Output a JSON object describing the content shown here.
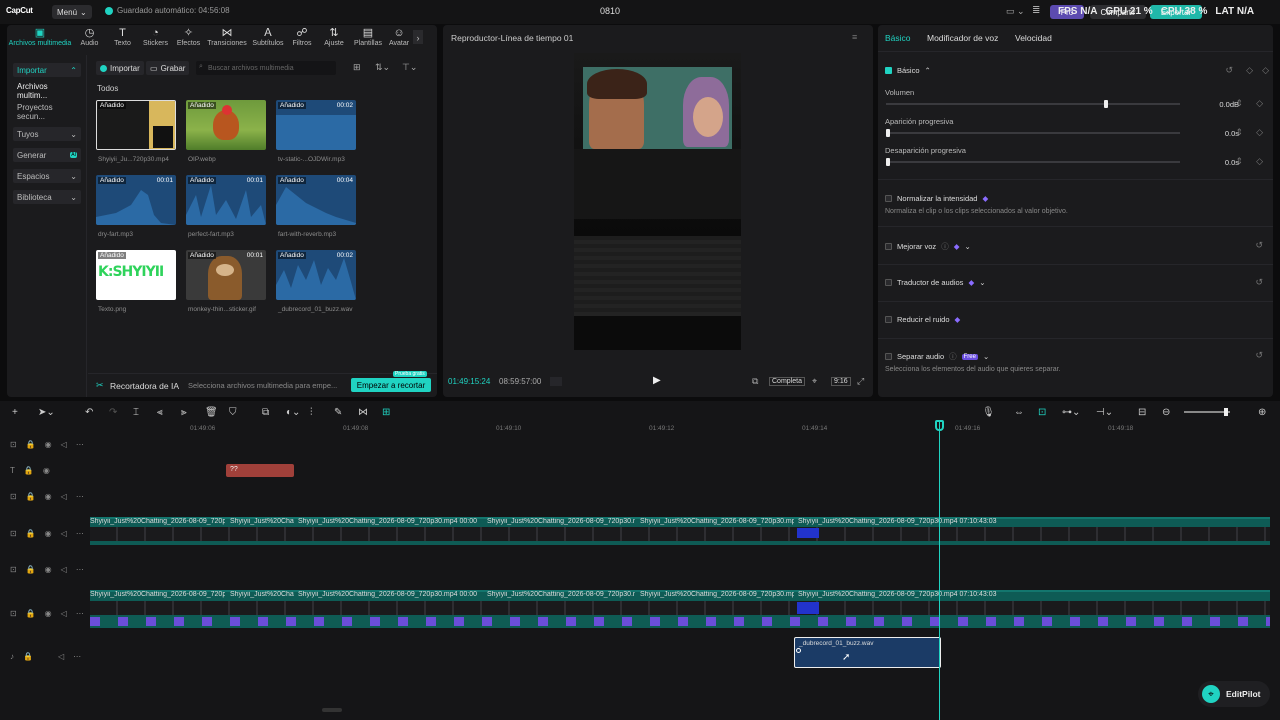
{
  "topbar": {
    "logo": "CapCut",
    "menu": "Menú",
    "autosave": "Guardado automático: 04:56:08",
    "project": "0810",
    "perf": [
      "FPS N/A",
      "GPU 21 %",
      "CPU 38 %",
      "LAT N/A"
    ],
    "pro": "Pro",
    "share": "Compartir",
    "export": "Exportar"
  },
  "toolbar": [
    "Archivos multimedia",
    "Audio",
    "Texto",
    "Stickers",
    "Efectos",
    "Transiciones",
    "Subtítulos",
    "Filtros",
    "Ajuste",
    "Plantillas",
    "Avatar"
  ],
  "toolbar_icons": [
    "media-icon",
    "audio-icon",
    "text-icon",
    "sticker-icon",
    "effects-icon",
    "transition-icon",
    "subtitle-icon",
    "filter-icon",
    "adjust-icon",
    "template-icon",
    "avatar-icon"
  ],
  "sidebar": {
    "import": "Importar",
    "media": "Archivos multim...",
    "projects": "Proyectos secun...",
    "yours": "Tuyos",
    "generate": "Generar",
    "generate_badge": "AI",
    "spaces": "Espacios",
    "library": "Biblioteca"
  },
  "media": {
    "import_btn": "Importar",
    "record_btn": "Grabar",
    "search_placeholder": "Buscar archivos multimedia",
    "all_label": "Todos",
    "items": [
      {
        "name": "Shyiyii_Ju...720p30.mp4",
        "tag": "Añadido",
        "dur": ""
      },
      {
        "name": "OIP.webp",
        "tag": "Añadido",
        "dur": ""
      },
      {
        "name": "tv-static-...OJDWir.mp3",
        "tag": "Añadido",
        "dur": "00:02"
      },
      {
        "name": "dry-fart.mp3",
        "tag": "Añadido",
        "dur": "00:01"
      },
      {
        "name": "perfect-fart.mp3",
        "tag": "Añadido",
        "dur": "00:01"
      },
      {
        "name": "fart-with-reverb.mp3",
        "tag": "Añadido",
        "dur": "00:04"
      },
      {
        "name": "Texto.png",
        "tag": "Añadido",
        "dur": ""
      },
      {
        "name": "monkey-thin...sticker.gif",
        "tag": "Añadido",
        "dur": "00:01"
      },
      {
        "name": "_dubrecord_01_buzz.wav",
        "tag": "Añadido",
        "dur": "00:02"
      }
    ],
    "texto_img": "K:SHYIYII",
    "ai_label": "Recortadora de IA",
    "ai_hint": "Selecciona archivos multimedia para empe...",
    "ai_btn": "Empezar a recortar",
    "ai_badge": "Prueba gratis"
  },
  "player": {
    "title": "Reproductor-Línea de tiempo 01",
    "current": "01:49:15:24",
    "total": "08:59:57:00",
    "full": "Completa",
    "ratio": "9:16"
  },
  "props": {
    "tabs": [
      "Básico",
      "Modificador de voz",
      "Velocidad"
    ],
    "basic": "Básico",
    "volume": "Volumen",
    "volume_val": "0.0dB",
    "volume_level": 0.75,
    "fade_in": "Aparición progresiva",
    "fade_in_val": "0.0s",
    "fade_out": "Desaparición progresiva",
    "fade_out_val": "0.0s",
    "normalize": "Normalizar la intensidad",
    "normalize_desc": "Normaliza el clip o los clips seleccionados al valor objetivo.",
    "enhance": "Mejorar voz",
    "translate": "Traductor de audios",
    "denoise": "Reducir el ruido",
    "separate": "Separar audio",
    "separate_badge": "Free",
    "separate_desc": "Selecciona los elementos del audio que quieres separar."
  },
  "timeline": {
    "ticks": [
      "01:49:06",
      "01:49:08",
      "01:49:10",
      "01:49:12",
      "01:49:14",
      "01:49:16",
      "01:49:18"
    ],
    "text_clip": "??",
    "clip_labels": [
      "Shyiyii_Just%20Chatting_2026-08-09_720p",
      "Shyiyii_Just%20Chat",
      "Shyiyii_Just%20Chatting_2026-08-09_720p30.mp4  00:00",
      "Shyiyii_Just%20Chatting_2026-08-09_720p30.n",
      "Shyiyii_Just%20Chatting_2026-08-09_720p30.mp",
      "Shyiyii_Just%20Chatting_2026-08-09_720p30.mp4  07:10:43:03"
    ],
    "audio_clip": "_dubrecord_01_buzz.wav",
    "editpilot": "EditPilot"
  },
  "colors": {
    "accent": "#20d3c2",
    "audio_clip": "#1b3b66",
    "text_clip": "#a0403a"
  }
}
